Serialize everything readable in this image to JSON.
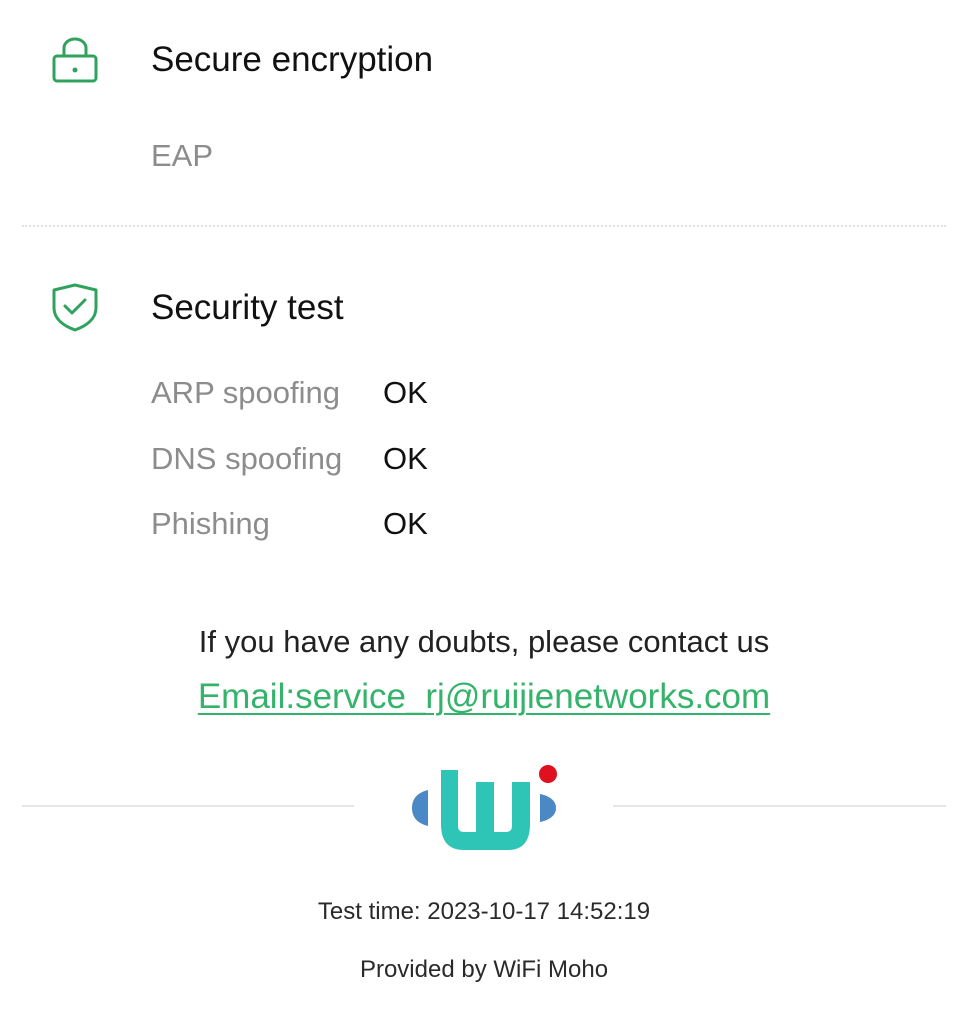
{
  "encryption": {
    "icon": "lock-icon",
    "title": "Secure encryption",
    "value": "EAP"
  },
  "security_test": {
    "icon": "shield-check-icon",
    "title": "Security test",
    "items": [
      {
        "label": "ARP spoofing",
        "value": "OK"
      },
      {
        "label": "DNS spoofing",
        "value": "OK"
      },
      {
        "label": "Phishing",
        "value": "OK"
      }
    ]
  },
  "contact": {
    "text": "If you have any doubts, please contact us",
    "email_text": "Email:service_rj@ruijienetworks.com"
  },
  "logo": {
    "icon": "wifi-moho-logo-icon"
  },
  "footer": {
    "test_time": "Test time: 2023-10-17 14:52:19",
    "provided_by": "Provided by WiFi Moho"
  },
  "colors": {
    "accent_green": "#2fa35e",
    "link_green": "#35b36a",
    "muted_text": "#8c8c8c",
    "logo_teal": "#2ec4b6",
    "logo_blue": "#4b88c6",
    "logo_red": "#e0101f"
  }
}
